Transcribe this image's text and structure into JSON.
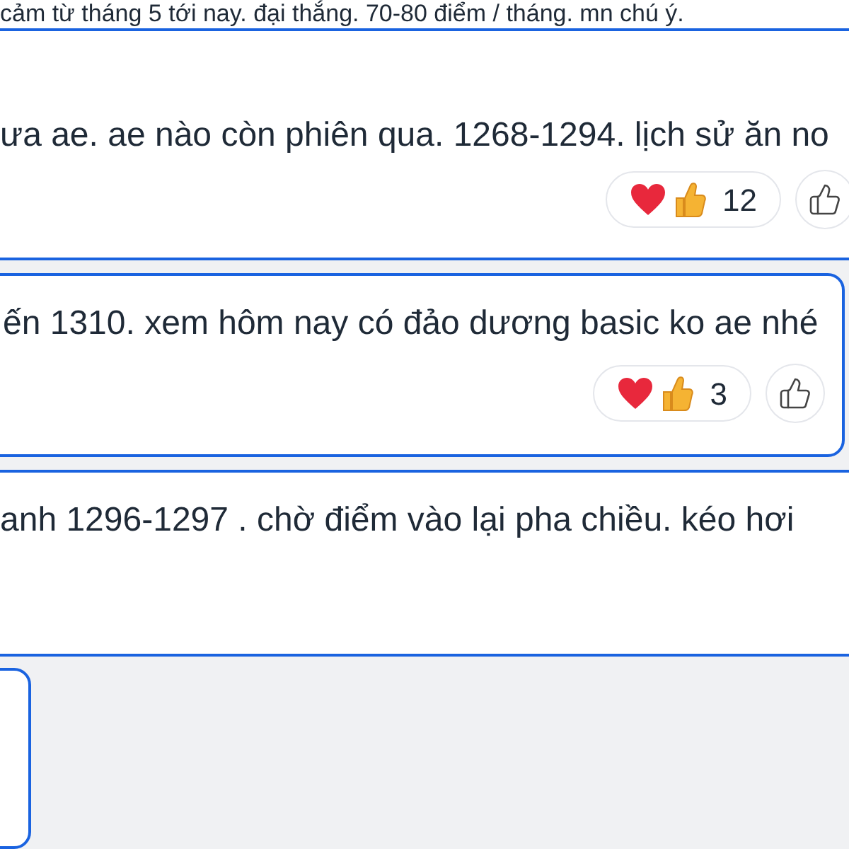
{
  "top_text": "cảm từ tháng 5 tới nay. đại thắng. 70-80 điểm / tháng. mn chú ý.",
  "comments": [
    {
      "kind": "wide",
      "text": "ưa ae. ae nào còn phiên qua. 1268-1294. lịch sử ăn no",
      "reaction_count": "12",
      "like_button": true
    },
    {
      "kind": "boxed",
      "text": "ến 1310. xem hôm nay có đảo dương basic ko ae nhé",
      "reaction_count": "3",
      "like_button": true
    },
    {
      "kind": "plain",
      "text": "anh 1296-1297 . chờ điểm vào lại pha chiều. kéo hơi"
    }
  ]
}
